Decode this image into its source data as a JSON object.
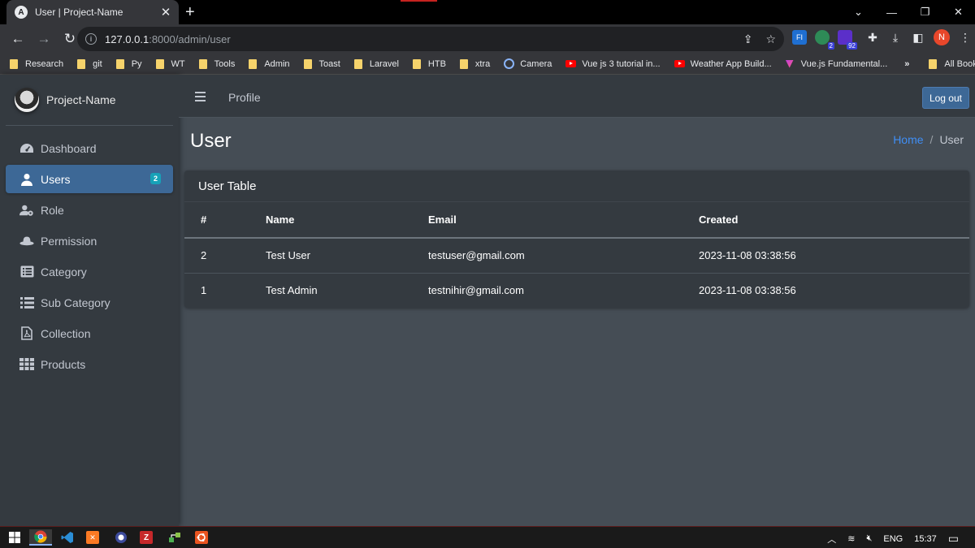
{
  "browser": {
    "tab_title": "User | Project-Name",
    "tab_favicon": "A",
    "url_host": "127.0.0.1",
    "url_path": ":8000/admin/user",
    "bookmarks": [
      "Research",
      "git",
      "Py",
      "WT",
      "Tools",
      "Admin",
      "Toast",
      "Laravel",
      "HTB",
      "xtra"
    ],
    "bookmark_camera": "Camera",
    "bookmark_videos": [
      "Vue js 3 tutorial in...",
      "Weather App Build..."
    ],
    "bookmark_vue": "Vue.js Fundamental...",
    "bookmark_more": "»",
    "all_bookmarks": "All Bookmarks",
    "profile_initial": "N",
    "ext_badge_1": "2",
    "ext_badge_2": "92"
  },
  "sidebar": {
    "brand": "Project-Name",
    "items": [
      {
        "label": "Dashboard",
        "icon": "dashboard-icon"
      },
      {
        "label": "Users",
        "icon": "user-icon",
        "count": "2"
      },
      {
        "label": "Role",
        "icon": "user-gear-icon"
      },
      {
        "label": "Permission",
        "icon": "hat-icon"
      },
      {
        "label": "Category",
        "icon": "list-alt-icon"
      },
      {
        "label": "Sub Category",
        "icon": "list-icon"
      },
      {
        "label": "Collection",
        "icon": "file-pdf-icon"
      },
      {
        "label": "Products",
        "icon": "grid-icon"
      }
    ]
  },
  "header": {
    "profile_link": "Profile",
    "logout": "Log out"
  },
  "page": {
    "title": "User",
    "breadcrumb_home": "Home",
    "breadcrumb_sep": "/",
    "breadcrumb_current": "User"
  },
  "table": {
    "title": "User Table",
    "columns": [
      "#",
      "Name",
      "Email",
      "Created"
    ],
    "rows": [
      [
        "2",
        "Test User",
        "testuser@gmail.com",
        "2023-11-08 03:38:56"
      ],
      [
        "1",
        "Test Admin",
        "testnihir@gmail.com",
        "2023-11-08 03:38:56"
      ]
    ]
  },
  "taskbar": {
    "language": "ENG",
    "time": "15:37"
  },
  "colors": {
    "sidebar_bg": "#343a40",
    "content_bg": "#454d55",
    "active_item": "#3d6896",
    "badge": "#17a2b8",
    "link": "#3f8ef5"
  }
}
